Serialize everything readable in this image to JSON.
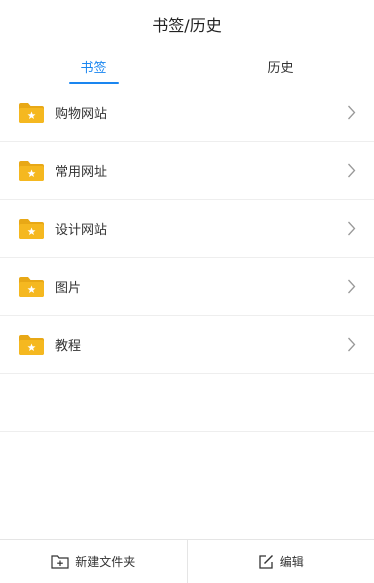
{
  "header": {
    "title": "书签/历史"
  },
  "tabs": [
    {
      "label": "书签",
      "active": true
    },
    {
      "label": "历史",
      "active": false
    }
  ],
  "folders": [
    {
      "label": "购物网站",
      "icon": "folder-star-icon"
    },
    {
      "label": "常用网址",
      "icon": "folder-star-icon"
    },
    {
      "label": "设计网站",
      "icon": "folder-star-icon"
    },
    {
      "label": "图片",
      "icon": "folder-star-icon"
    },
    {
      "label": "教程",
      "icon": "folder-star-icon"
    }
  ],
  "bottom": {
    "new_folder_label": "新建文件夹",
    "edit_label": "编辑"
  },
  "colors": {
    "accent": "#1a86f0",
    "folder": "#f5b820",
    "folder_tab": "#e8a816",
    "star": "#ffffff"
  }
}
